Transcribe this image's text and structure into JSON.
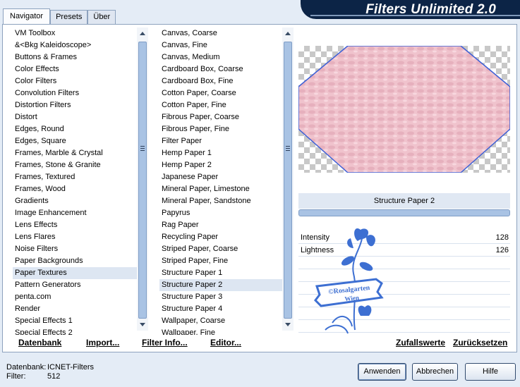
{
  "app": {
    "title": "Filters Unlimited 2.0"
  },
  "tabs": [
    {
      "label": "Navigator",
      "active": true
    },
    {
      "label": "Presets",
      "active": false
    },
    {
      "label": "Über",
      "active": false
    }
  ],
  "categories": {
    "items": [
      "VM Toolbox",
      "&<Bkg Kaleidoscope>",
      "Buttons & Frames",
      "Color Effects",
      "Color Filters",
      "Convolution Filters",
      "Distortion Filters",
      "Distort",
      "Edges, Round",
      "Edges, Square",
      "Frames, Marble & Crystal",
      "Frames, Stone & Granite",
      "Frames, Textured",
      "Frames, Wood",
      "Gradients",
      "Image Enhancement",
      "Lens Effects",
      "Lens Flares",
      "Noise Filters",
      "Paper Backgrounds",
      "Paper Textures",
      "Pattern Generators",
      "penta.com",
      "Render",
      "Special Effects 1",
      "Special Effects 2"
    ],
    "selected_index": 20
  },
  "filters": {
    "items": [
      "Canvas, Coarse",
      "Canvas, Fine",
      "Canvas, Medium",
      "Cardboard Box, Coarse",
      "Cardboard Box, Fine",
      "Cotton Paper, Coarse",
      "Cotton Paper, Fine",
      "Fibrous Paper, Coarse",
      "Fibrous Paper, Fine",
      "Filter Paper",
      "Hemp Paper 1",
      "Hemp Paper 2",
      "Japanese Paper",
      "Mineral Paper, Limestone",
      "Mineral Paper, Sandstone",
      "Papyrus",
      "Rag Paper",
      "Recycling Paper",
      "Striped Paper, Coarse",
      "Striped Paper, Fine",
      "Structure Paper 1",
      "Structure Paper 2",
      "Structure Paper 3",
      "Structure Paper 4",
      "Wallpaper, Coarse",
      "Wallpaper, Fine"
    ],
    "selected_index": 21
  },
  "filter_name": "Structure Paper 2",
  "params": [
    {
      "label": "Intensity",
      "value": "128"
    },
    {
      "label": "Lightness",
      "value": "126"
    }
  ],
  "watermark": {
    "line1": "©Rosalgarten",
    "line2": "Wien"
  },
  "bottom_bar": {
    "datenbank": "Datenbank",
    "import": "Import...",
    "filter_info": "Filter Info...",
    "editor": "Editor...",
    "zufallswerte": "Zufallswerte",
    "zuruecksetzen": "Zurücksetzen"
  },
  "status": {
    "db_label": "Datenbank:",
    "db_value": "ICNET-Filters",
    "filter_label": "Filter:",
    "filter_value": "512"
  },
  "buttons": {
    "apply": "Anwenden",
    "cancel": "Abbrechen",
    "help": "Hilfe"
  },
  "colors": {
    "banner": "#0c2446",
    "preview_fill": "#f1c6cf",
    "preview_edge": "#3c5fd6",
    "watermark": "#3d6fd2"
  }
}
